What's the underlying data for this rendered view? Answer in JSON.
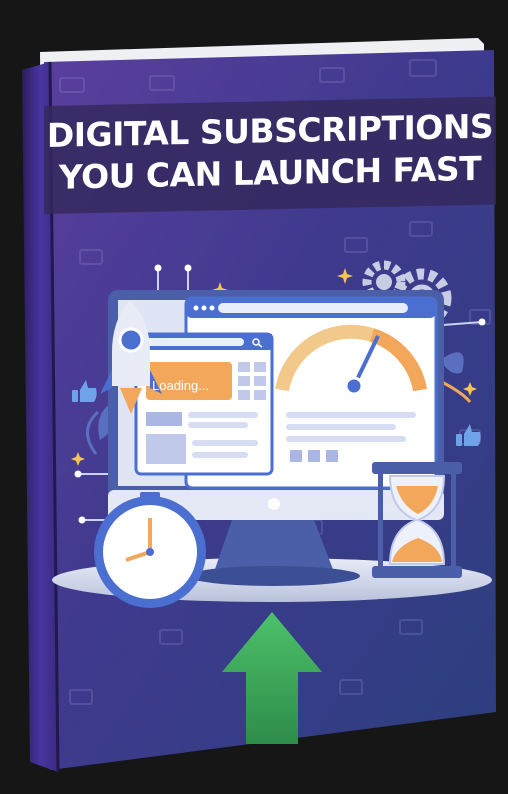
{
  "cover": {
    "title_line_1": "DIGITAL SUBSCRIPTIONS",
    "title_line_2": "YOU CAN LAUNCH FAST",
    "loading_label": "Loading..."
  },
  "colors": {
    "background": "#161616",
    "cover_top": "#5b3f9e",
    "cover_bottom": "#3d2a86",
    "spine": "#3b2a7c",
    "monitor_frame": "#4a5fa8",
    "gauge_orange": "#f2a75a",
    "arrow_green": "#4cc16a",
    "hourglass_sand": "#f2a75a"
  },
  "icons": [
    "rocket-icon",
    "gear-icon",
    "stopwatch-icon",
    "hourglass-icon",
    "thumbs-up-icon",
    "leaf-icon",
    "up-arrow-icon",
    "money-bill-icon",
    "speedometer-icon",
    "search-icon"
  ]
}
